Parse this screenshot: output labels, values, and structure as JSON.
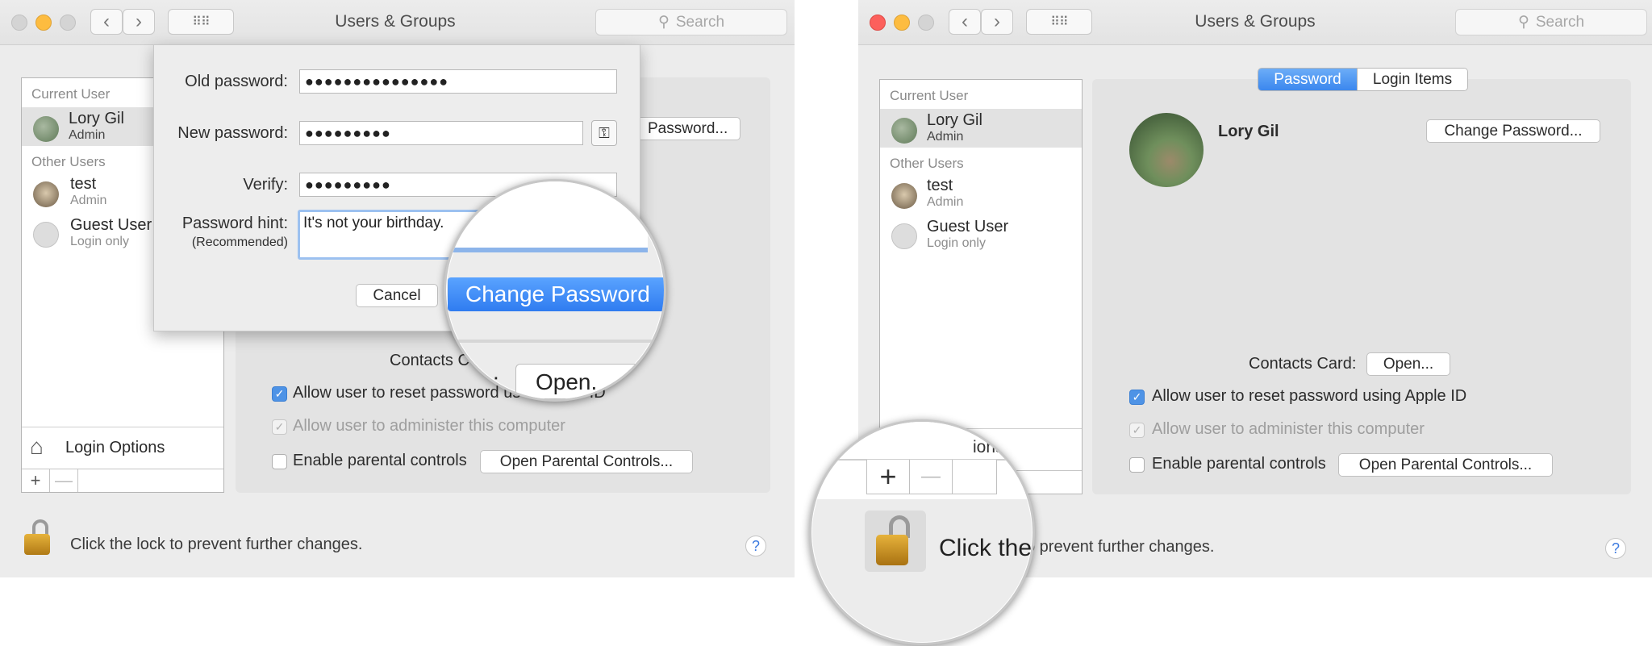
{
  "window_title": "Users & Groups",
  "search_placeholder": "Search",
  "sidebar": {
    "current_user_header": "Current User",
    "current_user": {
      "name": "Lory  Gil",
      "role": "Admin"
    },
    "other_users_header": "Other Users",
    "other_users": [
      {
        "name": "test",
        "role": "Admin"
      },
      {
        "name": "Guest User",
        "role": "Login only"
      }
    ],
    "login_options": "Login Options",
    "add_symbol": "+",
    "remove_symbol": "—"
  },
  "main": {
    "tabs": [
      "Password",
      "Login Items"
    ],
    "user_name": "Lory  Gil",
    "change_password": "Change Password...",
    "contacts_card_label": "Contacts Card:",
    "open_button": "Open...",
    "allow_reset": "Allow user to reset password using Apple ID",
    "allow_admin": "Allow user to administer this computer",
    "parental_controls": "Enable parental controls",
    "open_parental": "Open Parental Controls...",
    "lock_text": "Click the lock to prevent further changes.",
    "help": "?"
  },
  "left_visible": {
    "change_password_partial": "Password...",
    "contacts_partial": "Contacts C",
    "allow_reset_partial": "Allow user to reset password us",
    "allow_reset_tail": "e ID"
  },
  "dialog": {
    "old_password_label": "Old password:",
    "old_password_value": "●●●●●●●●●●●●●●●",
    "new_password_label": "New password:",
    "new_password_value": "●●●●●●●●●",
    "verify_label": "Verify:",
    "verify_value": "●●●●●●●●●",
    "hint_label": "Password hint:",
    "hint_sub": "(Recommended)",
    "hint_value": "It's not your birthday.",
    "cancel": "Cancel"
  },
  "magnifier_left": {
    "button": "Change Password",
    "partial_label": ":",
    "open_partial": "Open."
  },
  "magnifier_right": {
    "plus": "+",
    "minus": "—",
    "partial_text": "Click the",
    "ions_partial": "ions"
  },
  "colors": {
    "accent": "#3b82f0",
    "window_bg": "#ececec",
    "close": "#fc605c",
    "minimize": "#fdbc40",
    "zoom": "#c8c8c8"
  }
}
